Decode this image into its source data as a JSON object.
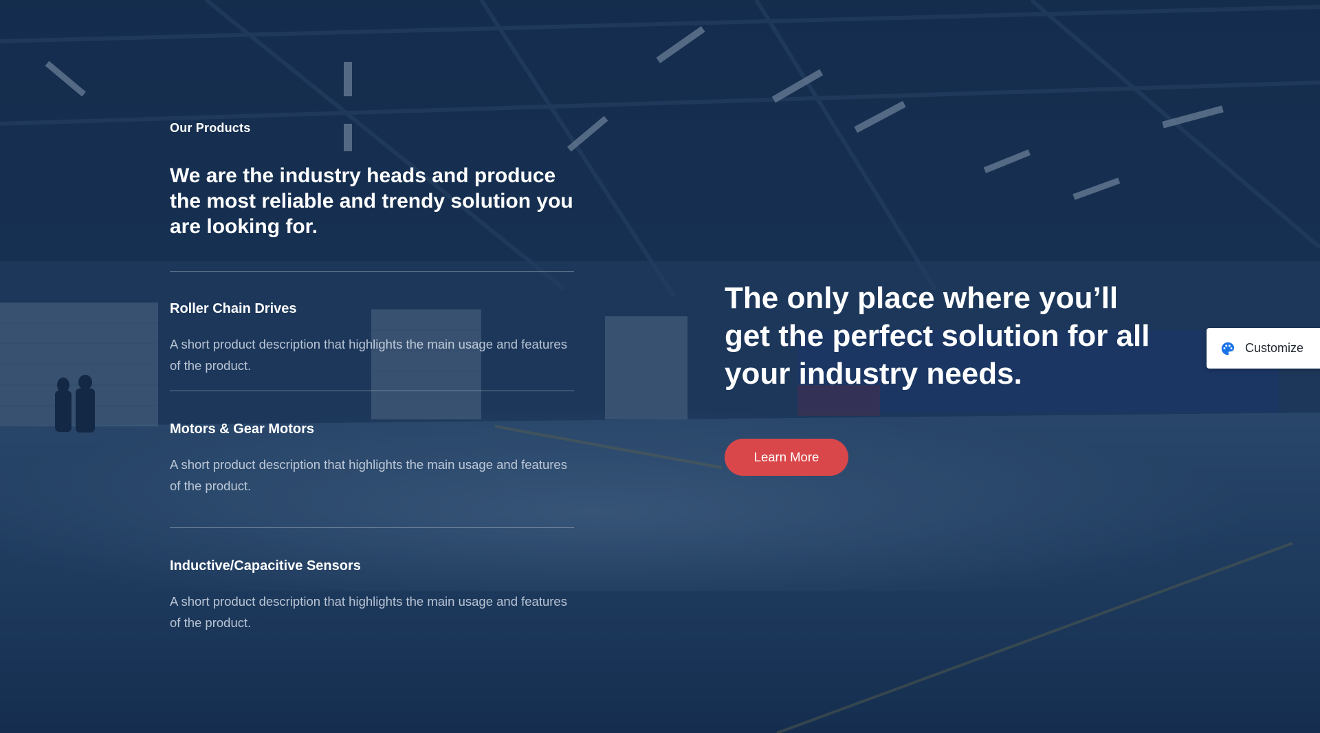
{
  "section": {
    "eyebrow": "Our Products",
    "intro": "We are the industry heads and produce the most reliable and trendy solution you are looking for."
  },
  "products": [
    {
      "title": "Roller Chain Drives",
      "description": "A short product description that highlights the main usage and features of the product."
    },
    {
      "title": "Motors & Gear Motors",
      "description": "A short product description that highlights the main usage and features of the product."
    },
    {
      "title": "Inductive/Capacitive Sensors",
      "description": "A short product description that highlights the main usage and features of the product."
    }
  ],
  "hero": {
    "headline": "The only place where you’ll get the perfect solution for all your industry needs.",
    "cta_label": "Learn More"
  },
  "customize": {
    "label": "Customize",
    "icon": "palette-icon"
  },
  "colors": {
    "overlay": "#0f2648",
    "accent": "#d9474a",
    "customize_icon": "#1a73e8"
  }
}
